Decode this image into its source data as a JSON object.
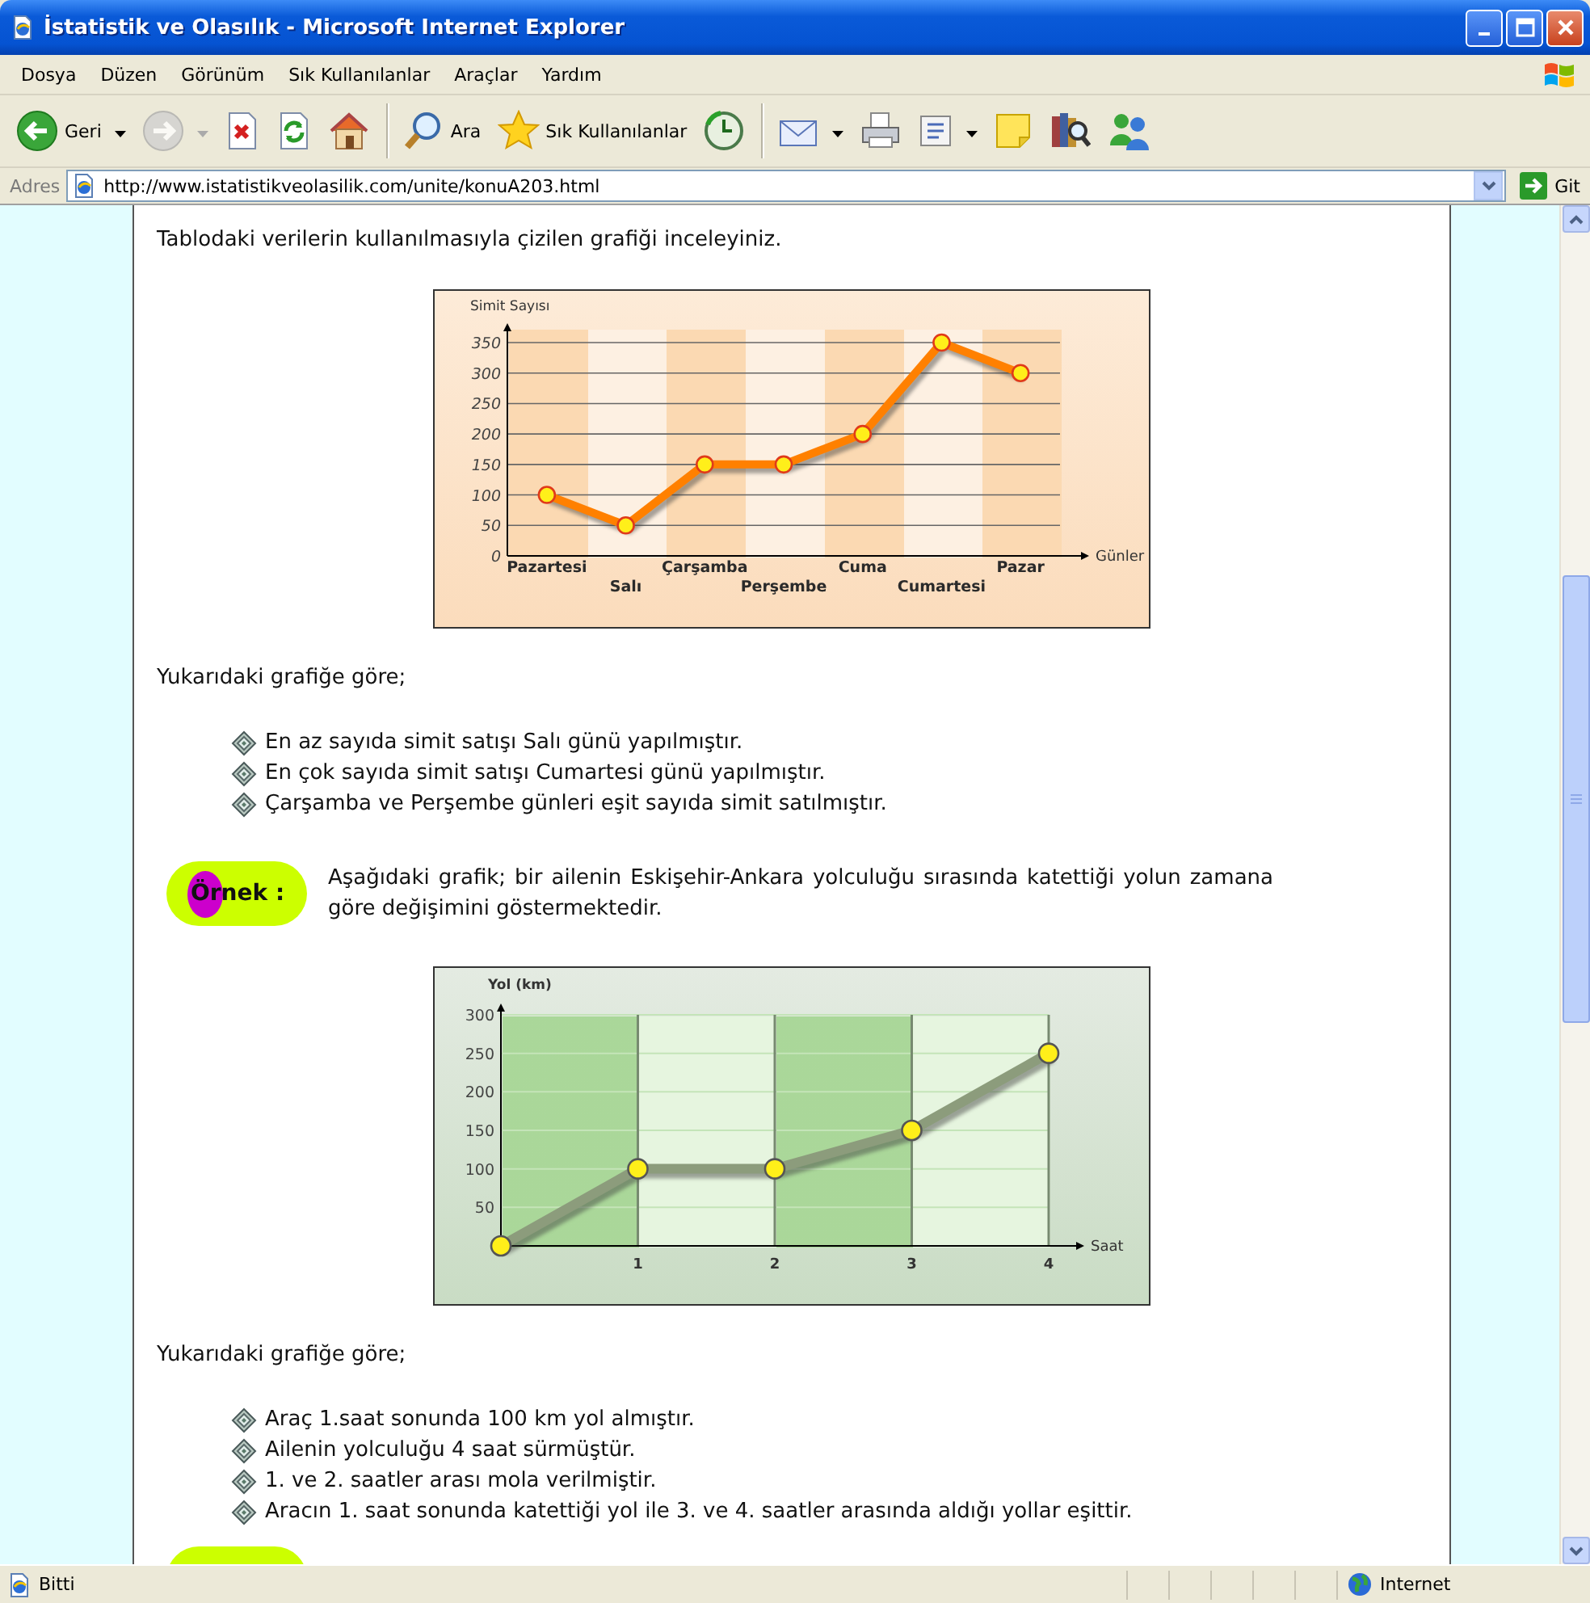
{
  "window": {
    "title": "İstatistik ve Olasılık - Microsoft Internet Explorer"
  },
  "menu": [
    "Dosya",
    "Düzen",
    "Görünüm",
    "Sık Kullanılanlar",
    "Araçlar",
    "Yardım"
  ],
  "toolbar": [
    {
      "kind": "back",
      "label": "Geri",
      "disabled": false
    },
    {
      "kind": "forward",
      "disabled": true
    },
    {
      "kind": "stop",
      "disabled": false
    },
    {
      "kind": "refresh",
      "disabled": false
    },
    {
      "kind": "home",
      "disabled": false
    },
    {
      "kind": "separator"
    },
    {
      "kind": "search",
      "label": "Ara",
      "disabled": false
    },
    {
      "kind": "favorites",
      "label": "Sık Kullanılanlar",
      "disabled": false
    },
    {
      "kind": "media",
      "disabled": false
    },
    {
      "kind": "separator"
    },
    {
      "kind": "mail",
      "disabled": false
    },
    {
      "kind": "print",
      "disabled": false
    },
    {
      "kind": "edit",
      "disabled": false
    },
    {
      "kind": "notes",
      "disabled": false
    },
    {
      "kind": "research",
      "disabled": false
    },
    {
      "kind": "messenger",
      "disabled": false
    }
  ],
  "address_bar": {
    "label": "Adres",
    "value": "http://www.istatistikveolasilik.com/unite/konuA203.html",
    "go": "Git"
  },
  "content": [
    {
      "kind": "paragraph",
      "text": "Tablodaki verilerin kullanılmasıyla çizilen grafiği inceleyiniz."
    },
    {
      "kind": "chart",
      "chart_data": {
        "type": "line",
        "ylabel": "Simit Sayısı",
        "xlabel": "Günler",
        "categories": [
          "Pazartesi",
          "Salı",
          "Çarşamba",
          "Perşembe",
          "Cuma",
          "Cumartesi",
          "Pazar"
        ],
        "ylim": [
          0,
          350
        ],
        "yticks": [
          0,
          50,
          100,
          150,
          200,
          250,
          300,
          350
        ],
        "grid": true,
        "series": [
          {
            "color": "#ff8000",
            "marker": "circle",
            "values": [
              100,
              50,
              150,
              150,
              200,
              350,
              300
            ]
          }
        ]
      }
    },
    {
      "kind": "paragraph",
      "text": "Yukarıdaki grafiğe göre;"
    },
    {
      "kind": "bullets",
      "items": [
        "En az sayıda simit satışı Salı günü yapılmıştır.",
        "En çok sayıda simit satışı Cumartesi günü yapılmıştır.",
        "Çarşamba ve Perşembe günleri eşit sayıda simit satılmıştır."
      ]
    },
    {
      "kind": "example",
      "badge": "Örnek :",
      "text": "Aşağıdaki grafik; bir ailenin Eskişehir-Ankara yolculuğu sırasında katettiği yolun zamana göre değişimini göstermektedir."
    },
    {
      "kind": "chart",
      "chart_data": {
        "type": "line",
        "ylabel": "Yol (km)",
        "xlabel": "Saat",
        "x": [
          0,
          1,
          2,
          3,
          4
        ],
        "xlim": [
          0,
          4
        ],
        "ylim": [
          0,
          300
        ],
        "xticks": [
          1,
          2,
          3,
          4
        ],
        "yticks": [
          50,
          100,
          150,
          200,
          250,
          300
        ],
        "grid": true,
        "series": [
          {
            "color": "#8c9c7c",
            "marker": "circle",
            "values": [
              0,
              100,
              100,
              150,
              250
            ]
          }
        ]
      }
    },
    {
      "kind": "paragraph",
      "text": "Yukarıdaki grafiğe göre;"
    },
    {
      "kind": "bullets",
      "items": [
        "Araç 1.saat sonunda 100 km yol almıştır.",
        "Ailenin yolculuğu 4 saat sürmüştür.",
        "1. ve 2. saatler arası mola verilmiştir.",
        "Aracın 1. saat sonunda katettiği yol ile 3. ve 4. saatler arasında aldığı yollar eşittir."
      ]
    },
    {
      "kind": "cut_badge"
    }
  ],
  "status_bar": {
    "text": "Bitti",
    "zone": "Internet"
  }
}
